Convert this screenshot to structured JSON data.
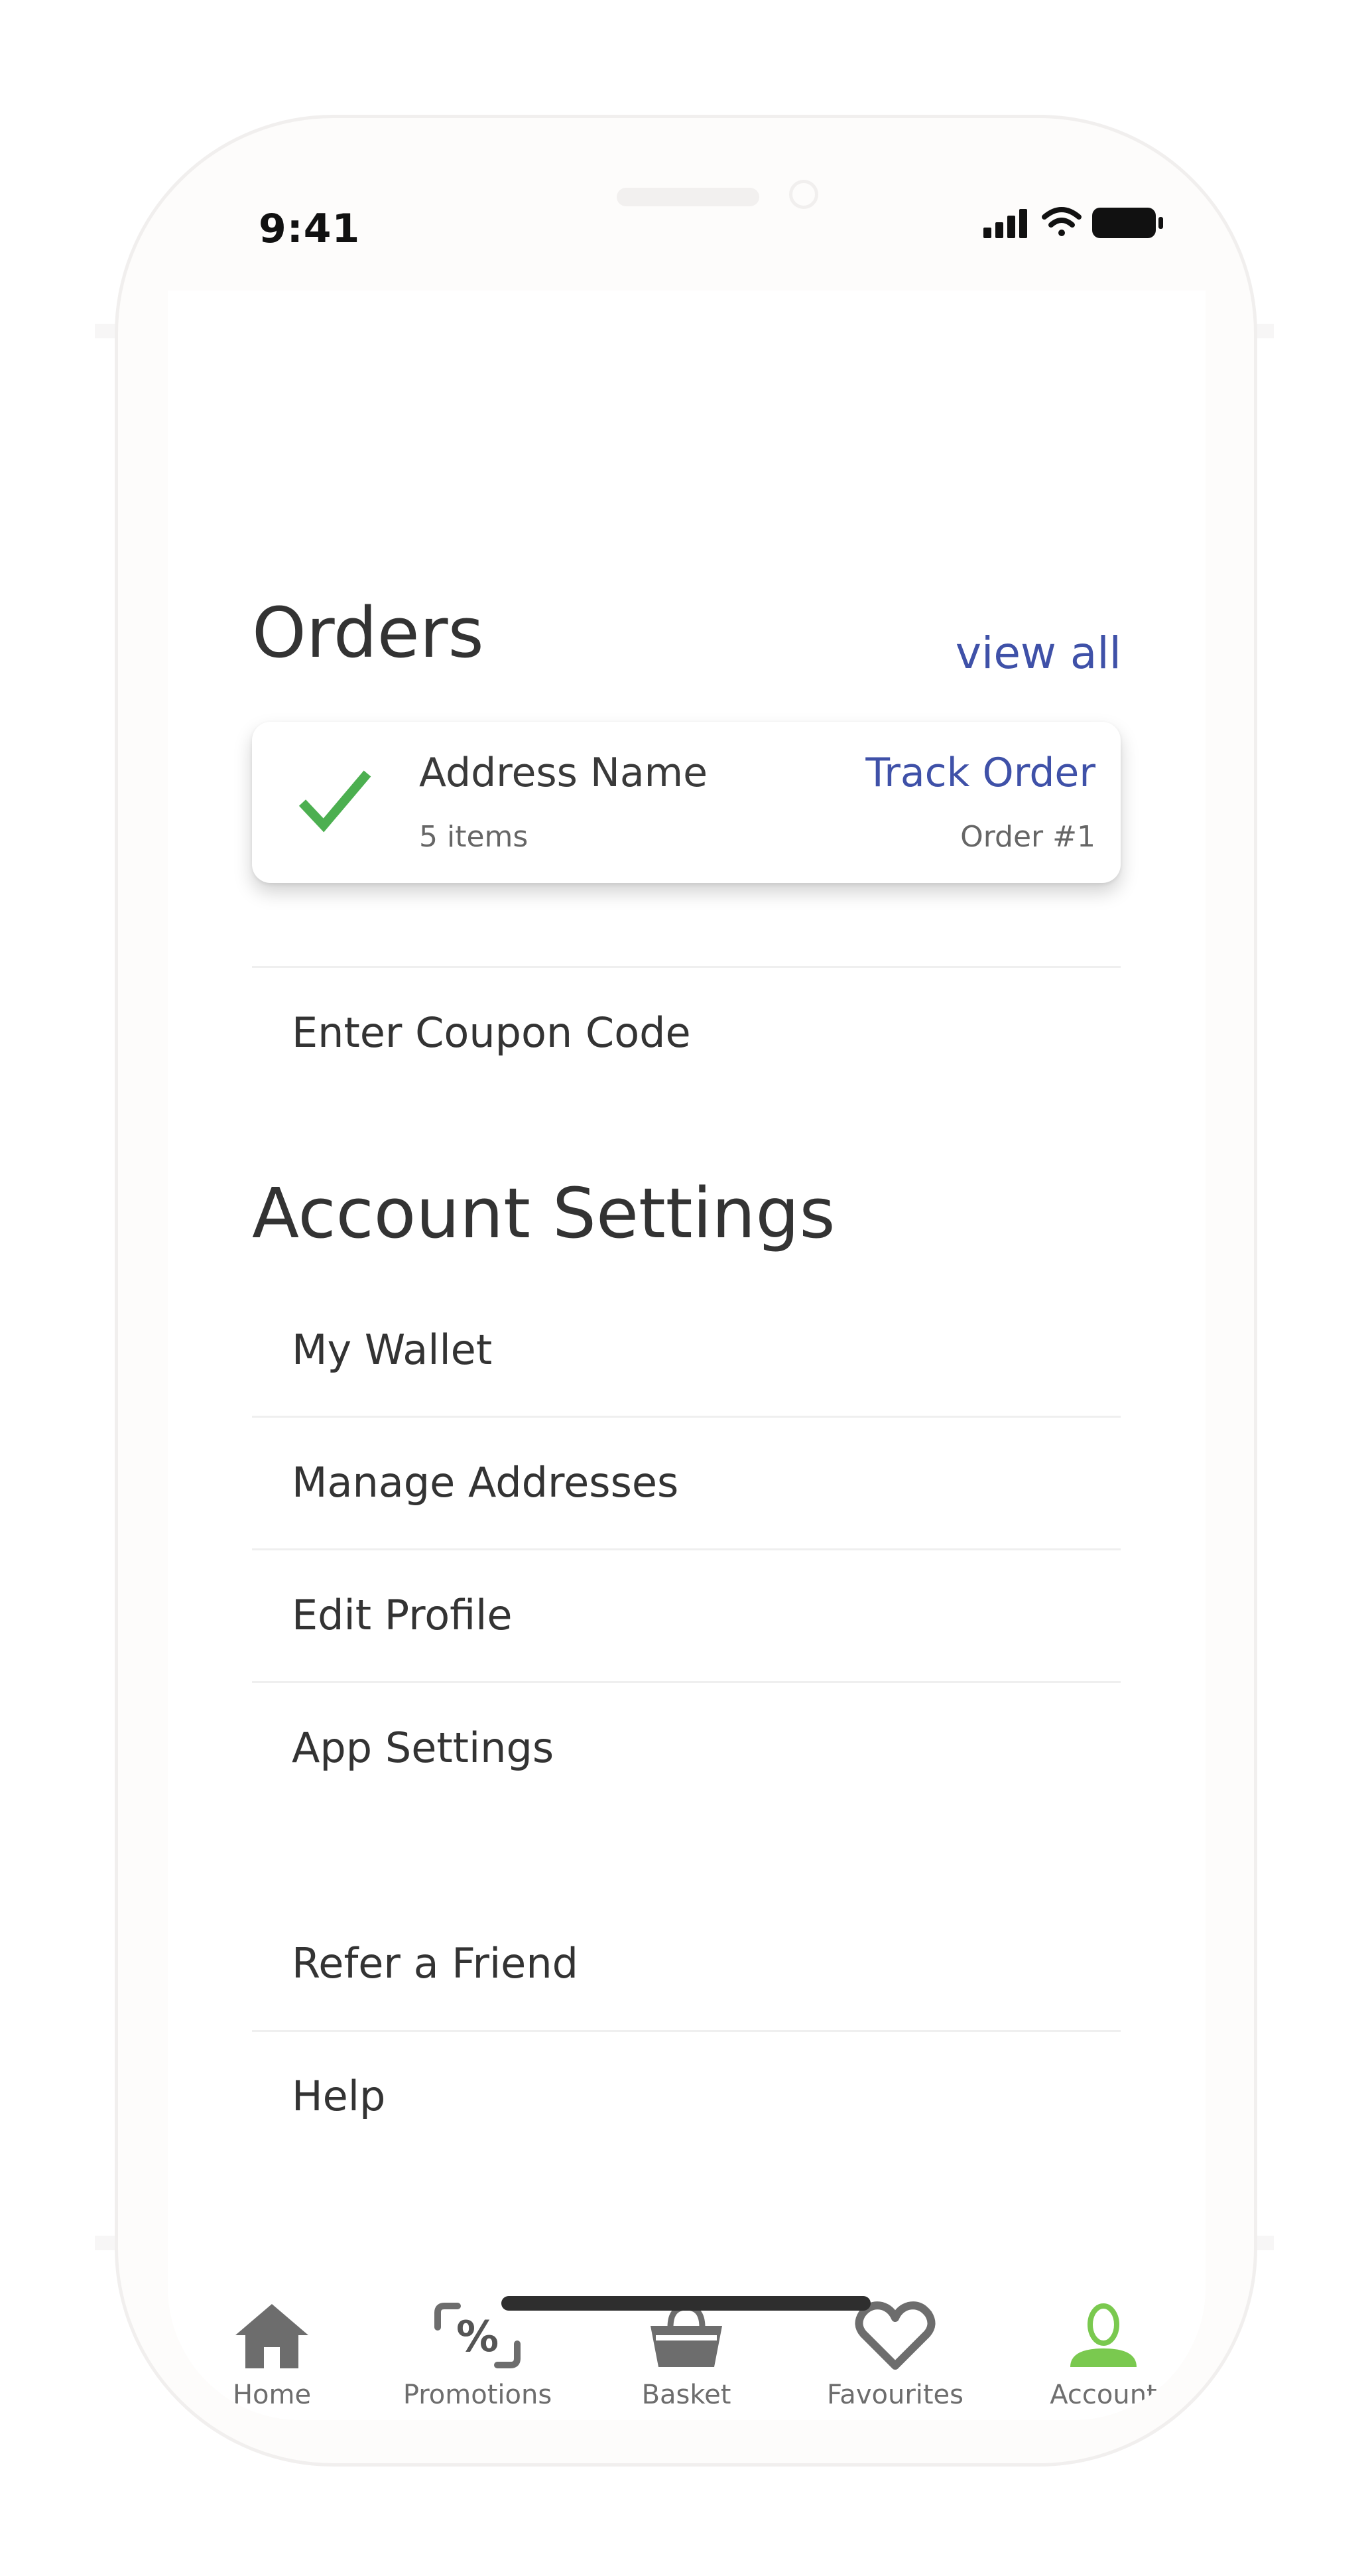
{
  "status_bar": {
    "time": "9:41"
  },
  "orders": {
    "title": "Orders",
    "view_all_label": "view all",
    "card": {
      "address_name": "Address Name",
      "items_count": "5 items",
      "track_label": "Track Order",
      "order_number": "Order #1"
    }
  },
  "coupon": {
    "label": "Enter Coupon Code"
  },
  "account_settings": {
    "title": "Account Settings",
    "items": [
      {
        "label": "My Wallet"
      },
      {
        "label": "Manage Addresses"
      },
      {
        "label": "Edit Profile"
      },
      {
        "label": "App Settings"
      }
    ]
  },
  "support": {
    "items": [
      {
        "label": "Refer a Friend"
      },
      {
        "label": "Help"
      }
    ]
  },
  "tab_bar": {
    "active": "Account",
    "tabs": [
      {
        "label": "Home",
        "icon": "home-icon"
      },
      {
        "label": "Promotions",
        "icon": "promotions-icon"
      },
      {
        "label": "Basket",
        "icon": "basket-icon"
      },
      {
        "label": "Favourites",
        "icon": "heart-icon"
      },
      {
        "label": "Account",
        "icon": "account-icon"
      }
    ]
  },
  "colors": {
    "link_blue": "#3f51a8",
    "check_green": "#4caf50",
    "active_tab_green": "#7ac94f",
    "icon_gray": "#6d6d6d"
  }
}
